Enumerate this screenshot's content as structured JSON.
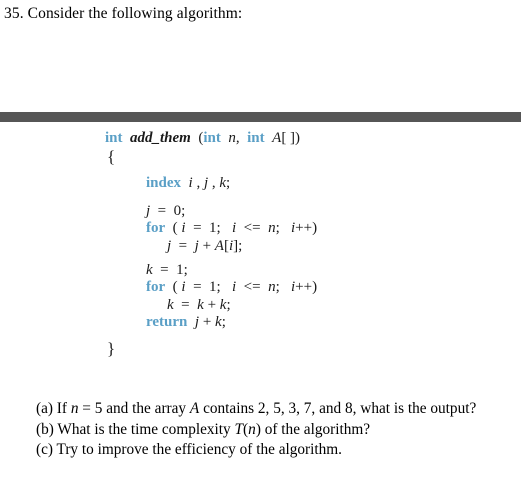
{
  "header": {
    "text": "35. Consider the following algorithm:"
  },
  "rule": {
    "color": "#565656"
  },
  "code": {
    "keyword_color": "#5a9fc6",
    "lines": [
      {
        "id": "signature",
        "indent": "ind0",
        "tokens": [
          {
            "text": "int",
            "style": "kw"
          },
          {
            "text": "  ",
            "style": "plain"
          },
          {
            "text": "add_them",
            "style": "fn"
          },
          {
            "text": "  (",
            "style": "plain"
          },
          {
            "text": "int",
            "style": "kw"
          },
          {
            "text": "  ",
            "style": "plain"
          },
          {
            "text": "n",
            "style": "var"
          },
          {
            "text": ",  ",
            "style": "plain"
          },
          {
            "text": "int",
            "style": "kw"
          },
          {
            "text": "  ",
            "style": "plain"
          },
          {
            "text": "A",
            "style": "var"
          },
          {
            "text": "[ ])",
            "style": "plain"
          }
        ]
      },
      {
        "id": "open-brace",
        "indent": "indbr",
        "tokens": [
          {
            "text": "{",
            "style": "brace"
          }
        ]
      },
      {
        "id": "declaration",
        "indent": "ind1",
        "tokens": [
          {
            "text": "index",
            "style": "kw"
          },
          {
            "text": "  ",
            "style": "plain"
          },
          {
            "text": "i",
            "style": "var"
          },
          {
            "text": " , ",
            "style": "plain"
          },
          {
            "text": "j",
            "style": "var"
          },
          {
            "text": " , ",
            "style": "plain"
          },
          {
            "text": "k",
            "style": "var"
          },
          {
            "text": ";",
            "style": "plain"
          }
        ]
      },
      {
        "id": "assign-j-zero",
        "indent": "ind1",
        "tokens": [
          {
            "text": "j",
            "style": "var"
          },
          {
            "text": "  =  0;",
            "style": "plain"
          }
        ]
      },
      {
        "id": "for-loop-1",
        "indent": "ind1",
        "tokens": [
          {
            "text": "for",
            "style": "kw"
          },
          {
            "text": "  ( ",
            "style": "plain"
          },
          {
            "text": "i",
            "style": "var"
          },
          {
            "text": "  =  1;   ",
            "style": "plain"
          },
          {
            "text": "i",
            "style": "var"
          },
          {
            "text": "  <=  ",
            "style": "plain"
          },
          {
            "text": "n",
            "style": "var"
          },
          {
            "text": ";   ",
            "style": "plain"
          },
          {
            "text": "i",
            "style": "var"
          },
          {
            "text": "++)",
            "style": "plain"
          }
        ]
      },
      {
        "id": "for-body-1",
        "indent": "ind2",
        "tokens": [
          {
            "text": "j",
            "style": "var"
          },
          {
            "text": "  =  ",
            "style": "plain"
          },
          {
            "text": "j",
            "style": "var"
          },
          {
            "text": " + ",
            "style": "plain"
          },
          {
            "text": "A",
            "style": "var"
          },
          {
            "text": "[",
            "style": "plain"
          },
          {
            "text": "i",
            "style": "var"
          },
          {
            "text": "];",
            "style": "plain"
          }
        ]
      },
      {
        "id": "assign-k-one",
        "indent": "ind1",
        "tokens": [
          {
            "text": "k",
            "style": "var"
          },
          {
            "text": "  =  1;",
            "style": "plain"
          }
        ]
      },
      {
        "id": "for-loop-2",
        "indent": "ind1",
        "tokens": [
          {
            "text": "for",
            "style": "kw"
          },
          {
            "text": "  ( ",
            "style": "plain"
          },
          {
            "text": "i",
            "style": "var"
          },
          {
            "text": "  =  1;   ",
            "style": "plain"
          },
          {
            "text": "i",
            "style": "var"
          },
          {
            "text": "  <=  ",
            "style": "plain"
          },
          {
            "text": "n",
            "style": "var"
          },
          {
            "text": ";   ",
            "style": "plain"
          },
          {
            "text": "i",
            "style": "var"
          },
          {
            "text": "++)",
            "style": "plain"
          }
        ]
      },
      {
        "id": "for-body-2",
        "indent": "ind2",
        "tokens": [
          {
            "text": "k",
            "style": "var"
          },
          {
            "text": "  =  ",
            "style": "plain"
          },
          {
            "text": "k",
            "style": "var"
          },
          {
            "text": " + ",
            "style": "plain"
          },
          {
            "text": "k",
            "style": "var"
          },
          {
            "text": ";",
            "style": "plain"
          }
        ]
      },
      {
        "id": "return-statement",
        "indent": "ind1",
        "tokens": [
          {
            "text": "return",
            "style": "kw"
          },
          {
            "text": "  ",
            "style": "plain"
          },
          {
            "text": "j",
            "style": "var"
          },
          {
            "text": " + ",
            "style": "plain"
          },
          {
            "text": "k",
            "style": "var"
          },
          {
            "text": ";",
            "style": "plain"
          }
        ]
      },
      {
        "id": "close-brace",
        "indent": "indbr",
        "tokens": [
          {
            "text": "}",
            "style": "brace"
          }
        ]
      }
    ]
  },
  "questions": [
    {
      "id": "question-a",
      "parts": [
        {
          "text": "(a) If ",
          "style": "plain"
        },
        {
          "text": "n",
          "style": "italic"
        },
        {
          "text": " = 5 and the array ",
          "style": "plain"
        },
        {
          "text": "A",
          "style": "italic"
        },
        {
          "text": " contains 2, 5, 3, 7, and 8, what is the output?",
          "style": "plain"
        }
      ]
    },
    {
      "id": "question-b",
      "parts": [
        {
          "text": "(b) What is the time complexity ",
          "style": "plain"
        },
        {
          "text": "T",
          "style": "italic"
        },
        {
          "text": "(",
          "style": "plain"
        },
        {
          "text": "n",
          "style": "italic"
        },
        {
          "text": ") of the algorithm?",
          "style": "plain"
        }
      ]
    },
    {
      "id": "question-c",
      "parts": [
        {
          "text": "(c) Try to improve the efficiency of the algorithm.",
          "style": "plain"
        }
      ]
    }
  ]
}
